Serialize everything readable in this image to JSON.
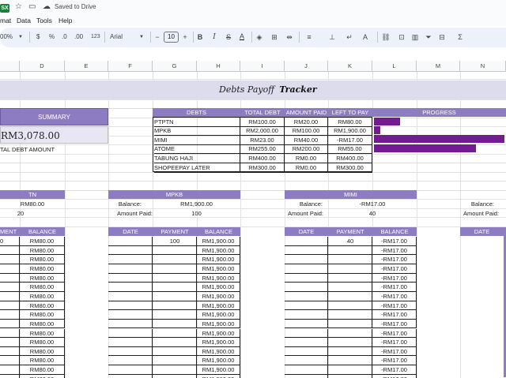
{
  "titlebar": {
    "file_badge": "SX",
    "saved_status": "Saved to Drive"
  },
  "menubar": {
    "items": [
      "mat",
      "Data",
      "Tools",
      "Help"
    ]
  },
  "toolbar": {
    "zoom": "00%",
    "currency": "$",
    "percent": "%",
    "dec_decrease": ".0",
    "dec_increase": ".00",
    "number_format": "123",
    "font": "Arial",
    "font_size": "10"
  },
  "columns": [
    "D",
    "E",
    "F",
    "G",
    "H",
    "I",
    "J",
    "K",
    "L",
    "M",
    "N"
  ],
  "sheet": {
    "title": "Debts Payoff",
    "title_bold": "Tracker",
    "summary": {
      "header": "SUMMARY",
      "amount": "RM3,078.00",
      "label": "TAL DEBT AMOUNT"
    },
    "debts_table": {
      "headers": [
        "DEBTS",
        "TOTAL DEBT",
        "AMOUNT PAID",
        "LEFT TO PAY"
      ],
      "rows": [
        [
          "PTPTN",
          "RM100.00",
          "RM20.00",
          "RM80.00"
        ],
        [
          "MPKB",
          "RM2,000.00",
          "RM100.00",
          "RM1,900.00"
        ],
        [
          "MIMI",
          "RM23.00",
          "RM40.00",
          "-RM17.00"
        ],
        [
          "ATOME",
          "RM255.00",
          "RM200.00",
          "RM55.00"
        ],
        [
          "TABUNG HAJI",
          "RM400.00",
          "RM0.00",
          "RM400.00"
        ],
        [
          "SHOPEEPAY LATER",
          "RM300.00",
          "RM0.00",
          "RM300.00"
        ]
      ],
      "progress_header": "PROGRESS",
      "progress": [
        0.2,
        0.05,
        1.0,
        0.78,
        0.0,
        0.0
      ]
    },
    "ptptn": {
      "header": "TN",
      "balance": "RM80.00",
      "paid": "20",
      "col_payment": "MENT",
      "col_balance": "BALANCE",
      "rows": [
        "RM80.00",
        "RM80.00",
        "RM80.00",
        "RM80.00",
        "RM80.00",
        "RM80.00",
        "RM80.00",
        "RM80.00",
        "RM80.00",
        "RM80.00",
        "RM80.00",
        "RM80.00",
        "RM80.00",
        "RM80.00",
        "RM80.00",
        "RM80.00"
      ]
    },
    "mpkb": {
      "header": "MPKB",
      "balance_label": "Balance:",
      "balance": "RM1,900.00",
      "paid_label": "Amount Paid:",
      "paid": "100",
      "col_date": "DATE",
      "col_payment": "PAYMENT",
      "col_balance": "BALANCE",
      "first_payment": "100",
      "rows": [
        "RM1,900.00",
        "RM1,900.00",
        "RM1,900.00",
        "RM1,900.00",
        "RM1,900.00",
        "RM1,900.00",
        "RM1,900.00",
        "RM1,900.00",
        "RM1,900.00",
        "RM1,900.00",
        "RM1,900.00",
        "RM1,900.00",
        "RM1,900.00",
        "RM1,900.00",
        "RM1,900.00",
        "RM1,900.00"
      ]
    },
    "mimi": {
      "header": "MIMI",
      "balance_label": "Balance:",
      "balance": "-RM17.00",
      "paid_label": "Amount Paid:",
      "paid": "40",
      "col_date": "DATE",
      "col_payment": "PAYMENT",
      "col_balance": "BALANCE",
      "first_payment": "40",
      "rows": [
        "-RM17.00",
        "-RM17.00",
        "-RM17.00",
        "-RM17.00",
        "-RM17.00",
        "-RM17.00",
        "-RM17.00",
        "-RM17.00",
        "-RM17.00",
        "-RM17.00",
        "-RM17.00",
        "-RM17.00",
        "-RM17.00",
        "-RM17.00",
        "-RM17.00",
        "-RM17.00"
      ]
    },
    "next": {
      "balance_label": "Balance:",
      "paid_label": "Amount Paid:",
      "col_date": "DATE"
    }
  },
  "colors": {
    "header_purple": "#8e7cc3",
    "bar_purple": "#741b93",
    "title_band": "#dcdcec"
  }
}
